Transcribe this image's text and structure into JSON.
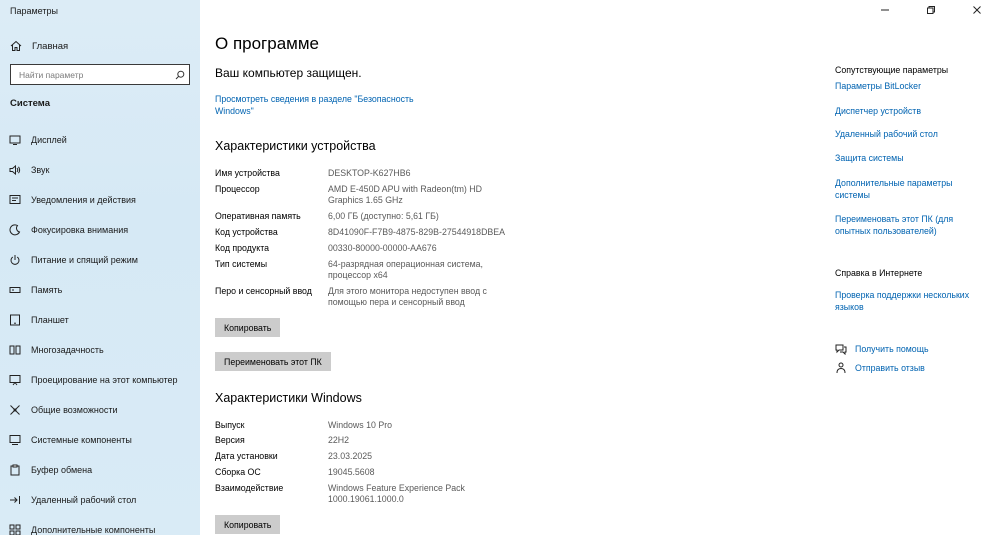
{
  "window": {
    "title": "Параметры"
  },
  "sidebar": {
    "home_label": "Главная",
    "search_placeholder": "Найти параметр",
    "section_label": "Система",
    "items": [
      {
        "label": "Дисплей",
        "icon": "display-icon"
      },
      {
        "label": "Звук",
        "icon": "sound-icon"
      },
      {
        "label": "Уведомления и действия",
        "icon": "notifications-icon"
      },
      {
        "label": "Фокусировка внимания",
        "icon": "focus-assist-icon"
      },
      {
        "label": "Питание и спящий режим",
        "icon": "power-icon"
      },
      {
        "label": "Память",
        "icon": "storage-icon"
      },
      {
        "label": "Планшет",
        "icon": "tablet-icon"
      },
      {
        "label": "Многозадачность",
        "icon": "multitasking-icon"
      },
      {
        "label": "Проецирование на этот компьютер",
        "icon": "projecting-icon"
      },
      {
        "label": "Общие возможности",
        "icon": "shared-experiences-icon"
      },
      {
        "label": "Системные компоненты",
        "icon": "system-components-icon"
      },
      {
        "label": "Буфер обмена",
        "icon": "clipboard-icon"
      },
      {
        "label": "Удаленный рабочий стол",
        "icon": "remote-desktop-icon"
      },
      {
        "label": "Дополнительные компоненты",
        "icon": "optional-features-icon"
      }
    ]
  },
  "main": {
    "title": "О программе",
    "protected_text": "Ваш компьютер защищен.",
    "security_link": "Просмотреть сведения в разделе \"Безопасность Windows\"",
    "device_heading": "Характеристики устройства",
    "device_specs": [
      {
        "key": "Имя устройства",
        "value": "DESKTOP-K627HB6"
      },
      {
        "key": "Процессор",
        "value": "AMD E-450D APU with Radeon(tm) HD Graphics   1.65 GHz"
      },
      {
        "key": "Оперативная память",
        "value": "6,00 ГБ (доступно: 5,61 ГБ)"
      },
      {
        "key": "Код устройства",
        "value": "8D41090F-F7B9-4875-829B-27544918DBEA"
      },
      {
        "key": "Код продукта",
        "value": "00330-80000-00000-AA676"
      },
      {
        "key": "Тип системы",
        "value": "64-разрядная операционная система, процессор x64"
      },
      {
        "key": "Перо и сенсорный ввод",
        "value": "Для этого монитора недоступен ввод с помощью пера и сенсорный ввод"
      }
    ],
    "copy_button": "Копировать",
    "rename_button": "Переименовать этот ПК",
    "windows_heading": "Характеристики Windows",
    "windows_specs": [
      {
        "key": "Выпуск",
        "value": "Windows 10 Pro"
      },
      {
        "key": "Версия",
        "value": "22H2"
      },
      {
        "key": "Дата установки",
        "value": "23.03.2025"
      },
      {
        "key": "Сборка ОС",
        "value": "19045.5608"
      },
      {
        "key": "Взаимодействие",
        "value": "Windows Feature Experience Pack 1000.19061.1000.0"
      }
    ],
    "copy_button_2": "Копировать"
  },
  "right": {
    "related_heading": "Сопутствующие параметры",
    "related_links": [
      "Параметры BitLocker",
      "Диспетчер устройств",
      "Удаленный рабочий стол",
      "Защита системы",
      "Дополнительные параметры системы",
      "Переименовать этот ПК (для опытных пользователей)"
    ],
    "help_heading": "Справка в Интернете",
    "help_link": "Проверка поддержки нескольких языков",
    "get_help": "Получить помощь",
    "feedback": "Отправить отзыв"
  }
}
